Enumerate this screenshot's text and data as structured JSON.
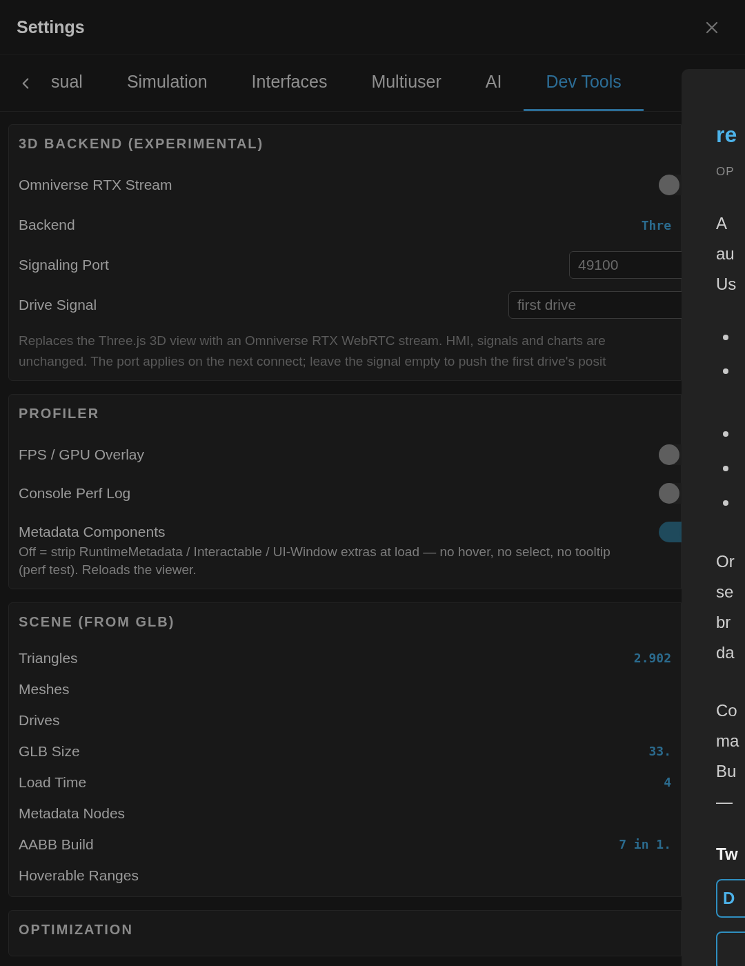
{
  "window": {
    "title": "Settings"
  },
  "tabs": [
    {
      "label": "sual",
      "selected": false
    },
    {
      "label": "Simulation",
      "selected": false
    },
    {
      "label": "Interfaces",
      "selected": false
    },
    {
      "label": "Multiuser",
      "selected": false
    },
    {
      "label": "AI",
      "selected": false
    },
    {
      "label": "Dev Tools",
      "selected": true
    }
  ],
  "sections": [
    {
      "title": "3D BACKEND (EXPERIMENTAL)",
      "rows": [
        {
          "kind": "toggle",
          "label": "Omniverse RTX Stream",
          "on": false
        },
        {
          "kind": "value",
          "label": "Backend",
          "value": "Thre"
        },
        {
          "kind": "input",
          "label": "Signaling Port",
          "value": "49100"
        },
        {
          "kind": "input",
          "label": "Drive Signal",
          "placeholder": "first drive"
        }
      ],
      "note": {
        "dimmed": true,
        "lines": [
          "Replaces the Three.js 3D view with an Omniverse RTX WebRTC stream. HMI, signals and charts are",
          "unchanged. The port applies on the next connect; leave the signal empty to push the first drive's posit"
        ]
      }
    },
    {
      "title": "PROFILER",
      "rows": [
        {
          "kind": "toggle",
          "label": "FPS / GPU Overlay",
          "on": false
        },
        {
          "kind": "toggle",
          "label": "Console Perf Log",
          "on": false
        },
        {
          "kind": "toggle",
          "label": "Metadata Components",
          "on": true
        }
      ],
      "note": {
        "dimmed": false,
        "lines": [
          "Off = strip RuntimeMetadata / Interactable / UI-Window extras at load — no hover, no select, no tooltip",
          "(perf test). Reloads the viewer."
        ]
      }
    },
    {
      "title": "SCENE (FROM GLB)",
      "rows": [
        {
          "kind": "value",
          "label": "Triangles",
          "value": "2.902"
        },
        {
          "kind": "value",
          "label": "Meshes"
        },
        {
          "kind": "value",
          "label": "Drives"
        },
        {
          "kind": "value",
          "label": "GLB Size",
          "value": "33."
        },
        {
          "kind": "value",
          "label": "Load Time",
          "value": "4"
        },
        {
          "kind": "value",
          "label": "Metadata Nodes"
        },
        {
          "kind": "value",
          "label": "AABB Build",
          "value": "7 in 1."
        },
        {
          "kind": "value",
          "label": "Hoverable Ranges"
        }
      ]
    },
    {
      "title": "OPTIMIZATION"
    }
  ],
  "side_panel": {
    "heading": "re",
    "eyebrow": "OP",
    "paragraph_1": [
      "A",
      "au",
      "Us"
    ],
    "paragraph_2": [
      "Or",
      "se",
      "br",
      "da"
    ],
    "paragraph_3": [
      "Co",
      "ma",
      "Bu",
      "—"
    ],
    "subheading": "Tw",
    "buttons": [
      "D"
    ]
  }
}
